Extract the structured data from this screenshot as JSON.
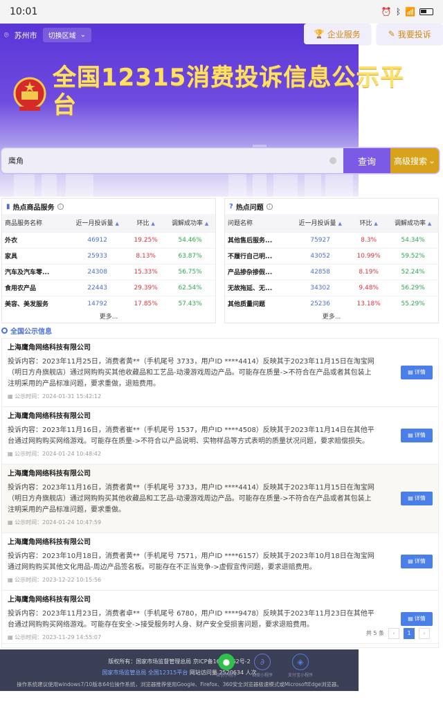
{
  "status_bar": {
    "time": "10:01"
  },
  "header": {
    "city": "苏州市",
    "switch_region": "切换区域",
    "enterprise_service": "企业服务",
    "complaint": "我要投诉",
    "title": "全国12315消费投诉信息公示平台"
  },
  "search": {
    "value": "鹰角",
    "button": "查询",
    "advanced": "高级搜索"
  },
  "hot_goods": {
    "title": "热点商品服务",
    "columns": [
      "商品服务名称",
      "近一月投诉量",
      "环比",
      "调解成功率"
    ],
    "rows": [
      {
        "name": "外衣",
        "count": "46912",
        "ratio": "19.25%",
        "success": "54.46%"
      },
      {
        "name": "家具",
        "count": "25933",
        "ratio": "8.13%",
        "success": "63.87%"
      },
      {
        "name": "汽车及汽车零...",
        "count": "24308",
        "ratio": "15.33%",
        "success": "56.75%"
      },
      {
        "name": "食用农产品",
        "count": "22443",
        "ratio": "29.39%",
        "success": "62.54%"
      },
      {
        "name": "美容、美发服务",
        "count": "14792",
        "ratio": "17.85%",
        "success": "57.43%"
      }
    ],
    "more": "更多..."
  },
  "hot_issues": {
    "title": "热点问题",
    "columns": [
      "问题名称",
      "近一月投诉量",
      "环比",
      "调解成功率"
    ],
    "rows": [
      {
        "name": "其他售后服务...",
        "count": "75927",
        "ratio": "8.3%",
        "success": "54.34%"
      },
      {
        "name": "不履行自己明...",
        "count": "43052",
        "ratio": "10.99%",
        "success": "59.52%"
      },
      {
        "name": "产品掺杂掺假...",
        "count": "42858",
        "ratio": "8.19%",
        "success": "52.24%"
      },
      {
        "name": "无故拖延、无...",
        "count": "34302",
        "ratio": "9.48%",
        "success": "56.29%"
      },
      {
        "name": "其他质量问题",
        "count": "25236",
        "ratio": "13.18%",
        "success": "55.29%"
      }
    ],
    "more": "更多..."
  },
  "public_info": {
    "title": "全国公示信息",
    "detail_label": "详情",
    "records": [
      {
        "company": "上海鹰角网络科技有限公司",
        "content": "投诉内容：2023年11月25日，消费者黄**（手机尾号 3733，用户ID ****4414）反映其于2023年11月15日在淘宝网（明日方舟旗舰店）通过网购购买其他收藏品和工艺品-动漫游戏周边产品。可能存在质量->不符合在产品或者其包装上注明采用的产品标准问题，要求重做，退赔费用。",
        "time": "公示时间：2024-01-31 15:42:12"
      },
      {
        "company": "上海鹰角网络科技有限公司",
        "content": "投诉内容：2023年11月16日，消费者崔**（手机尾号 1537，用户ID ****4508）反映其于2023年11月14日在其他平台通过网购购买网络游戏。可能存在质量->不符合以产品说明、实物样品等方式表明的质量状况问题，要求赔偿损失。",
        "time": "公示时间：2024-01-24 10:48:42"
      },
      {
        "company": "上海鹰角网络科技有限公司",
        "content": "投诉内容：2023年11月16日，消费者黄**（手机尾号 3733，用户ID ****4414）反映其于2023年11月15日在淘宝网（明日方舟旗舰店）通过网购购买其他收藏品和工艺品-动漫游戏周边产品。可能存在质量->不符合在产品或者其包装上注明采用的产品标准问题，要求重做。",
        "time": "公示时间：2024-01-24 10:47:59"
      },
      {
        "company": "上海鹰角网络科技有限公司",
        "content": "投诉内容：2023年10月18日，消费者黄**（手机尾号 7571，用户ID ****6157）反映其于2023年10月18日在淘宝网通过网购购买其他文化用品-周边产品签名板。可能存在不正当竞争->虚假宣传问题，要求退赔费用。",
        "time": "公示时间：2023-12-22 10:15:56"
      },
      {
        "company": "上海鹰角网络科技有限公司",
        "content": "投诉内容：2023年11月23日，消费者卓**（手机尾号 6780，用户ID ****9478）反映其于2023年11月23日在其他平台通过网购购买网络游戏。可能存在安全->接受服务时人身、财产安全受损害问题，要求退赔费用。",
        "time": "公示时间：2023-11-29 14:55:07"
      }
    ]
  },
  "pagination": {
    "total": "共 5 条",
    "current": "1",
    "prev": "‹",
    "next": "›"
  },
  "footer": {
    "line1": "版权所有：国家市场监督管理总局 京ICP备1603...62号-2",
    "line2_link1": "国家市场监管总局",
    "line2_link2": "全国12315平台",
    "line2_text": "网站访问量 2520634 人次",
    "line3": "操作系统建议使用windows7/10版本64位操作系统，浏览器推荐使用Google、Firefox、360安全浏览器极速模式或MicrosoftEdge浏览器。",
    "mini_app_1": "微信小程序",
    "mini_app_2": "百度小程序",
    "mini_app_3": "支付宝小程序"
  },
  "colors": {
    "brand_purple": "#6f4be0",
    "gold": "#d9a21b",
    "link_blue": "#4a6fd1",
    "up_red": "#e0323c",
    "success_green": "#2da84c"
  }
}
